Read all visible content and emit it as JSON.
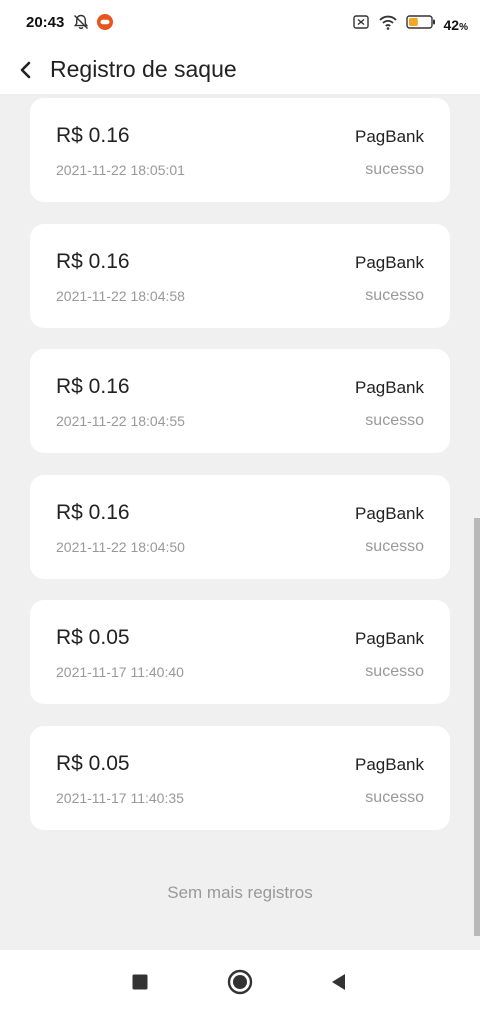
{
  "status_bar": {
    "time": "20:43",
    "battery_percent": "42",
    "battery_unit": "%",
    "battery_level": 0.42,
    "icons": [
      "bell-off-icon",
      "app-notification-icon",
      "sim-off-icon",
      "wifi-icon",
      "battery-icon"
    ]
  },
  "header": {
    "title": "Registro de saque",
    "back_icon": "chevron-left-icon"
  },
  "records": [
    {
      "amount": "R$ 0.16",
      "datetime": "2021-11-22 18:05:01",
      "bank": "PagBank",
      "status": "sucesso"
    },
    {
      "amount": "R$ 0.16",
      "datetime": "2021-11-22 18:04:58",
      "bank": "PagBank",
      "status": "sucesso"
    },
    {
      "amount": "R$ 0.16",
      "datetime": "2021-11-22 18:04:55",
      "bank": "PagBank",
      "status": "sucesso"
    },
    {
      "amount": "R$ 0.16",
      "datetime": "2021-11-22 18:04:50",
      "bank": "PagBank",
      "status": "sucesso"
    },
    {
      "amount": "R$ 0.05",
      "datetime": "2021-11-17 11:40:40",
      "bank": "PagBank",
      "status": "sucesso"
    },
    {
      "amount": "R$ 0.05",
      "datetime": "2021-11-17 11:40:35",
      "bank": "PagBank",
      "status": "sucesso"
    }
  ],
  "footer_text": "Sem mais registros",
  "nav_bar": {
    "buttons": [
      "recents-square-icon",
      "home-circle-icon",
      "back-triangle-icon"
    ]
  },
  "colors": {
    "background": "#f0f0f0",
    "card": "#ffffff",
    "secondary_text": "#999999",
    "notification_accent": "#e8541e",
    "battery_fill": "#f5a623"
  }
}
